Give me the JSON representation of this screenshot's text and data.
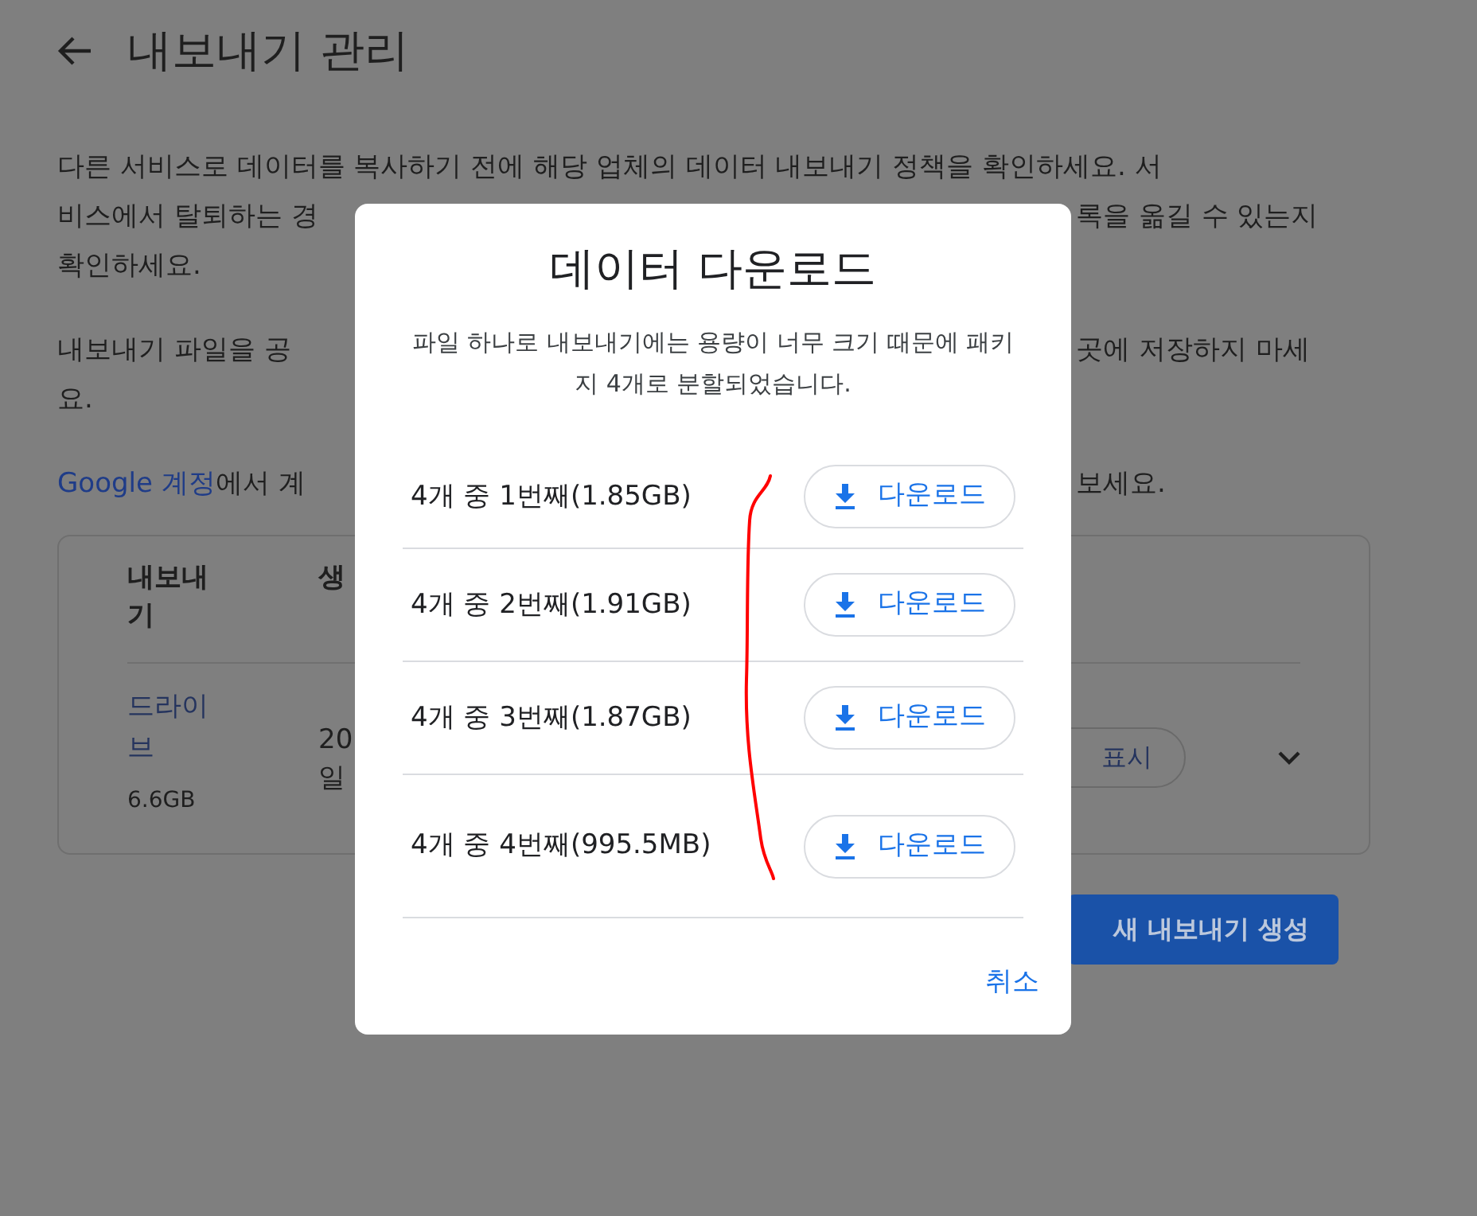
{
  "page": {
    "title": "내보내기 관리"
  },
  "paragraphs": [
    {
      "lines": [
        {
          "left": "다른 서비스로 데이터를 복사하기 전에 해당 업체의 데이터 내보내기 정책을 확인하세요. 서"
        },
        {
          "left": "비스에서 탈퇴하는 경",
          "right": "록을 옮길 수 있는지"
        },
        {
          "left": "확인하세요."
        }
      ]
    },
    {
      "lines": [
        {
          "left": "내보내기 파일을 공",
          "right": "곳에 저장하지 마세"
        },
        {
          "left": "요."
        }
      ]
    },
    {
      "lines": [
        {
          "link": "Google 계정",
          "left": "에서 계",
          "right": "보세요."
        }
      ]
    }
  ],
  "exports_table": {
    "columns": [
      {
        "label": "내보내기"
      },
      {
        "label": "생"
      }
    ],
    "rows": [
      {
        "service": "드라이브",
        "size": "6.6GB",
        "date_lines": [
          "20",
          "일"
        ],
        "action": "표시",
        "expanded": false
      }
    ]
  },
  "create_button": "새 내보내기 생성",
  "dialog": {
    "title": "데이터 다운로드",
    "description": "파일 하나로 내보내기에는 용량이 너무 크기 때문에 패키지 4개로 분할되었습니다.",
    "parts": [
      {
        "label": "4개 중 1번째(1.85GB)",
        "button": "다운로드"
      },
      {
        "label": "4개 중 2번째(1.91GB)",
        "button": "다운로드"
      },
      {
        "label": "4개 중 3번째(1.87GB)",
        "button": "다운로드"
      },
      {
        "label": "4개 중 4번째(995.5MB)",
        "button": "다운로드"
      }
    ],
    "cancel": "취소"
  }
}
